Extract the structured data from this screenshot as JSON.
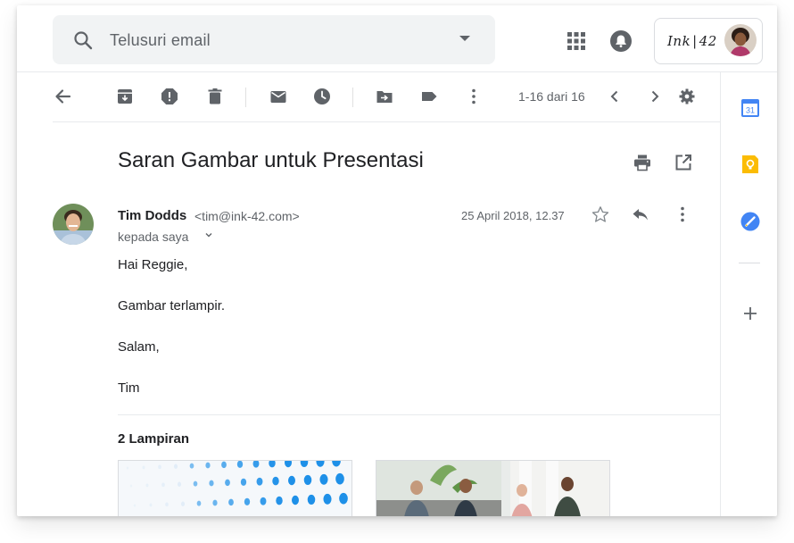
{
  "search": {
    "placeholder": "Telusuri email"
  },
  "account": {
    "brand": "Ink | 42"
  },
  "toolbar": {
    "pager": "1-16 dari 16"
  },
  "email": {
    "subject": "Saran Gambar untuk Presentasi",
    "sender_name": "Tim Dodds",
    "sender_email": "<tim@ink-42.com>",
    "to_line": "kepada saya",
    "date": "25 April 2018, 12.37",
    "body": [
      "Hai Reggie,",
      "Gambar terlampir.",
      "Salam,",
      "Tim"
    ],
    "attachments_title": "2 Lampiran"
  },
  "rightrail": {
    "calendar_day": "31"
  },
  "colors": {
    "accent_blue": "#1a73e8",
    "keep_yellow": "#fbbc04",
    "icon_grey": "#5f6368",
    "search_bg": "#f1f3f4"
  },
  "icons": [
    "search-icon",
    "apps-icon",
    "notification-bell-icon",
    "back-arrow-icon",
    "archive-icon",
    "report-spam-icon",
    "delete-icon",
    "mark-unread-icon",
    "snooze-icon",
    "move-to-icon",
    "label-icon",
    "more-vert-icon",
    "chevron-left-icon",
    "chevron-right-icon",
    "settings-icon",
    "print-icon",
    "open-in-new-icon",
    "star-icon",
    "reply-icon",
    "calendar-icon",
    "keep-icon",
    "tasks-icon",
    "add-icon"
  ]
}
